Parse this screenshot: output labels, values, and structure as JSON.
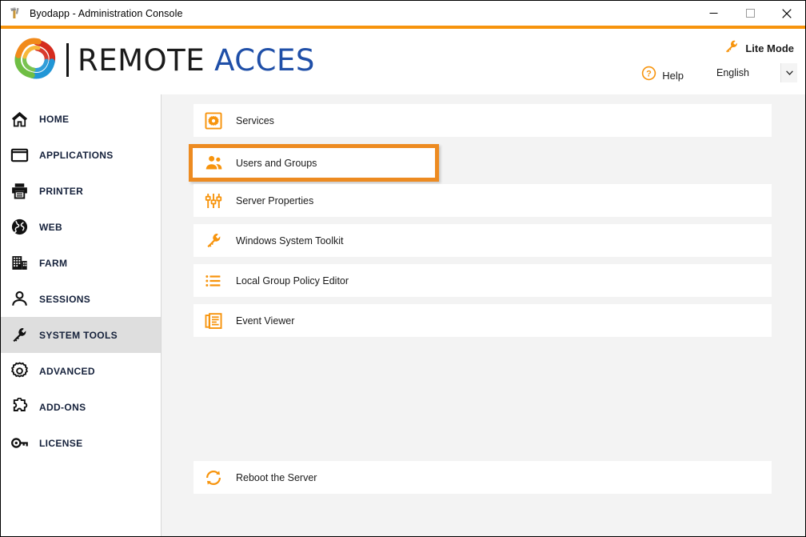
{
  "window": {
    "title": "Byodapp - Administration Console",
    "app_icon": "tools-hammer-icon",
    "controls": {
      "minimize": "minimize-button",
      "maximize": "maximize-button",
      "close": "close-button"
    }
  },
  "header": {
    "brand": {
      "word1": "REMOTE",
      "word2": "ACCES",
      "logo_icon": "pinwheel-logo-icon"
    },
    "lite_mode": {
      "label": "Lite Mode",
      "icon": "wrench-icon"
    },
    "help": {
      "label": "Help",
      "icon": "help-circle-icon"
    },
    "language": {
      "value": "English",
      "icon": "chevron-down-icon"
    }
  },
  "sidebar": {
    "items": [
      {
        "label": "HOME",
        "icon": "home-icon",
        "active": false
      },
      {
        "label": "APPLICATIONS",
        "icon": "window-icon",
        "active": false
      },
      {
        "label": "PRINTER",
        "icon": "printer-icon",
        "active": false
      },
      {
        "label": "WEB",
        "icon": "globe-icon",
        "active": false
      },
      {
        "label": "FARM",
        "icon": "building-icon",
        "active": false
      },
      {
        "label": "SESSIONS",
        "icon": "user-icon",
        "active": false
      },
      {
        "label": "SYSTEM TOOLS",
        "icon": "wrench-icon",
        "active": true
      },
      {
        "label": "ADVANCED",
        "icon": "gear-icon",
        "active": false
      },
      {
        "label": "ADD-ONS",
        "icon": "puzzle-icon",
        "active": false
      },
      {
        "label": "LICENSE",
        "icon": "key-icon",
        "active": false
      }
    ]
  },
  "main": {
    "tools": [
      {
        "label": "Services",
        "icon": "gear-square-icon",
        "highlighted": false
      },
      {
        "label": "Users and Groups",
        "icon": "users-icon",
        "highlighted": true
      },
      {
        "label": "Server Properties",
        "icon": "sliders-icon",
        "highlighted": false
      },
      {
        "label": "Windows System Toolkit",
        "icon": "wrench-icon",
        "highlighted": false
      },
      {
        "label": "Local Group Policy Editor",
        "icon": "list-icon",
        "highlighted": false
      },
      {
        "label": "Event Viewer",
        "icon": "event-log-icon",
        "highlighted": false
      }
    ],
    "reboot": {
      "label": "Reboot the Server",
      "icon": "refresh-icon"
    }
  },
  "colors": {
    "accent_orange": "#F7940D",
    "highlight_orange": "#ED8B21",
    "brand_blue": "#1F4FA8",
    "content_bg": "#F3F3F3",
    "sidebar_active": "#DEDEDE"
  }
}
